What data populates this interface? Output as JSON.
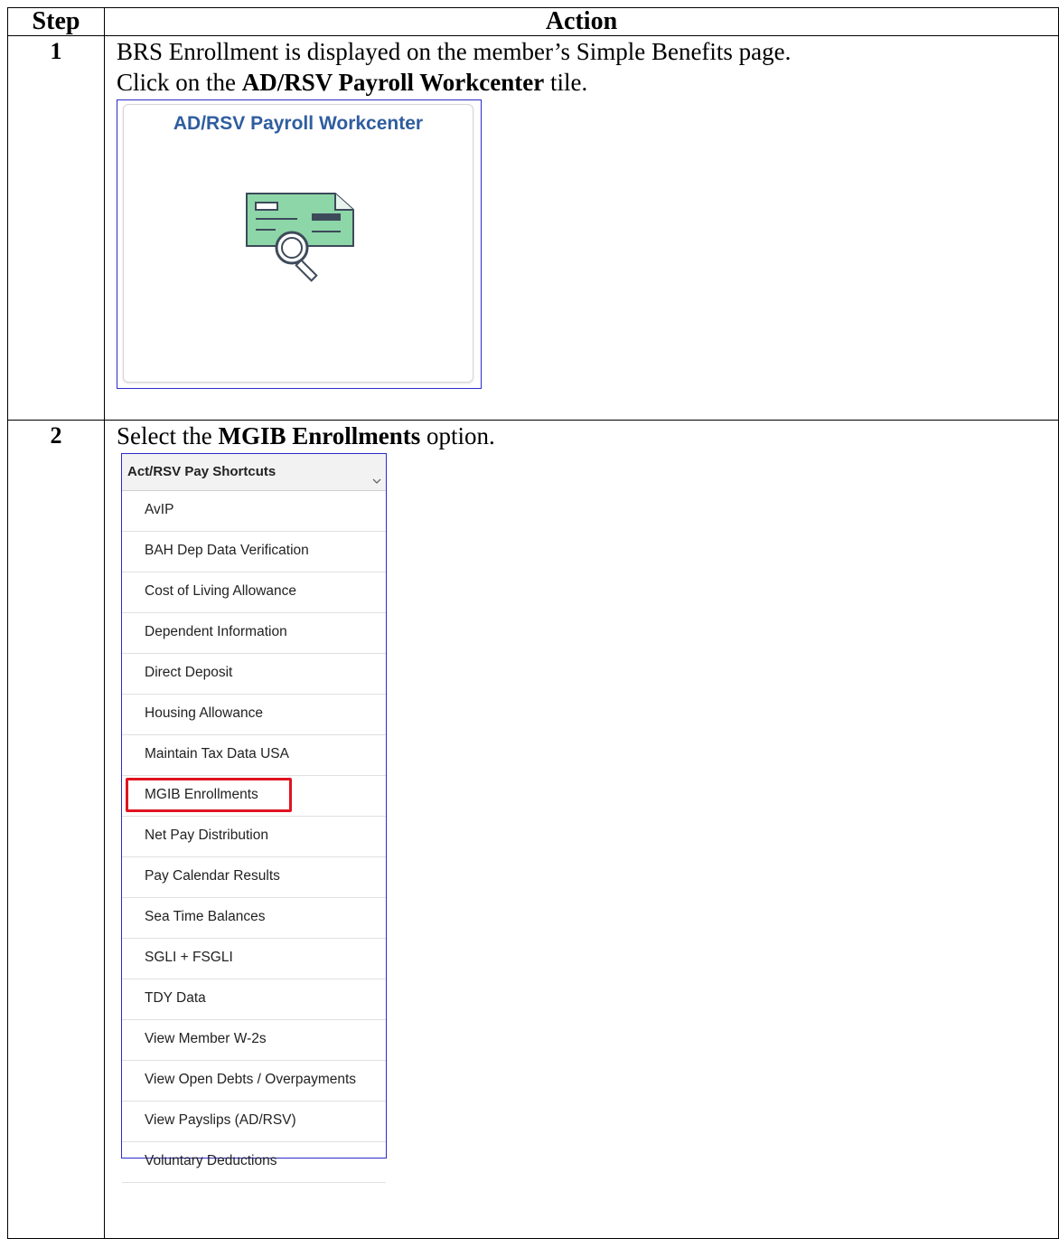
{
  "table": {
    "header_step": "Step",
    "header_action": "Action"
  },
  "steps": [
    {
      "number": "1",
      "line1": "BRS Enrollment is displayed on the member’s Simple Benefits page.",
      "line2_pre": "Click on the ",
      "line2_bold": "AD/RSV Payroll Workcenter",
      "line2_post": " tile.",
      "tile": {
        "title": "AD/RSV Payroll Workcenter",
        "icon": "check-search-icon"
      }
    },
    {
      "number": "2",
      "line1_pre": "Select the ",
      "line1_bold": "MGIB Enrollments",
      "line1_post": " option.",
      "menu": {
        "title": "Act/RSV Pay Shortcuts",
        "chevron_icon": "chevron-down-icon",
        "items": [
          "AvIP",
          "BAH Dep Data Verification",
          "Cost of Living Allowance",
          "Dependent Information",
          "Direct Deposit",
          "Housing Allowance",
          "Maintain Tax Data USA",
          "MGIB Enrollments",
          "Net Pay Distribution",
          "Pay Calendar Results",
          "Sea Time Balances",
          "SGLI + FSGLI",
          "TDY Data",
          "View Member W-2s",
          "View Open Debts / Overpayments",
          "View Payslips (AD/RSV)",
          "Voluntary Deductions"
        ],
        "highlighted_item": "MGIB Enrollments",
        "highlight_color": "#e0131f"
      }
    }
  ]
}
